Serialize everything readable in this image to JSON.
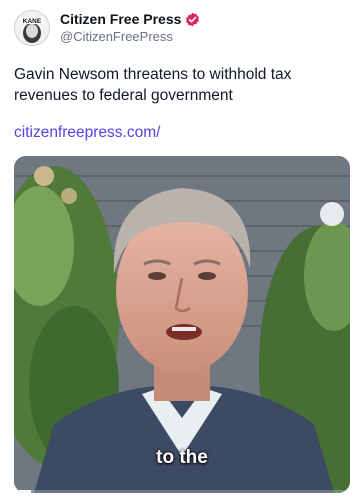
{
  "post": {
    "author": {
      "display_name": "Citizen Free Press",
      "handle": "@CitizenFreePress",
      "avatar_text": "KANE",
      "verified_icon": "verified-badge-icon",
      "verified_color": "#e0245e"
    },
    "text": "Gavin Newsom threatens to withhold tax revenues to federal government",
    "link": "citizenfreepress.com/",
    "video": {
      "caption": "to the",
      "progress": 0.05
    }
  },
  "colors": {
    "link": "#4f46e5",
    "text": "#111827",
    "muted": "#6b7280"
  }
}
